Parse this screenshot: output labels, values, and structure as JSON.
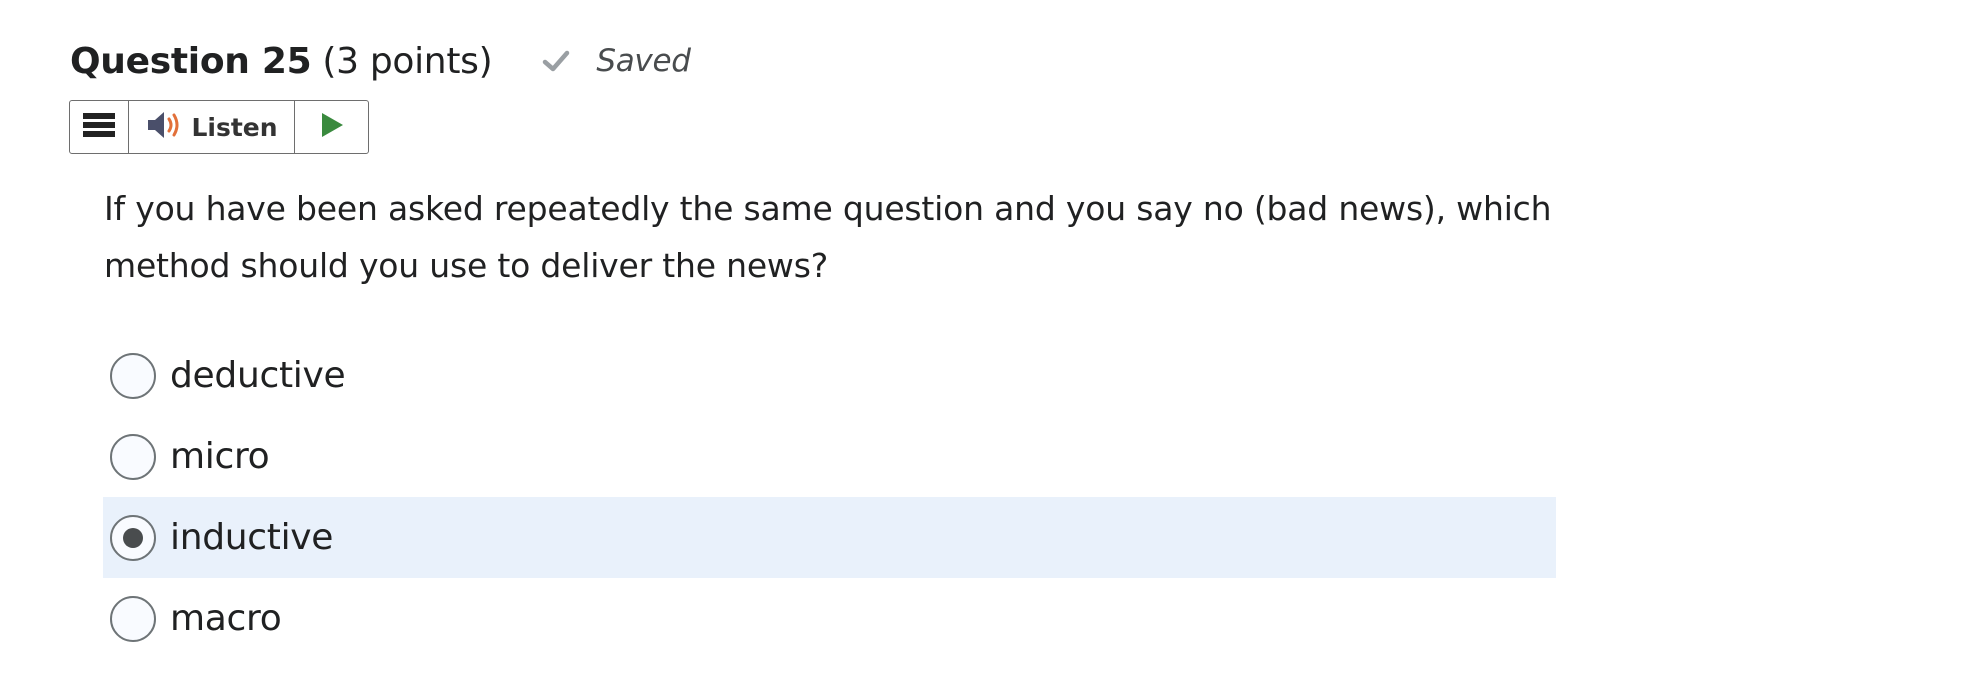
{
  "question": {
    "title": "Question 25",
    "points": "(3 points)",
    "status": "Saved",
    "text": "If you have been asked repeatedly the same question and you say no (bad news), which method should you use to deliver the news?",
    "options": [
      {
        "label": "deductive",
        "selected": false
      },
      {
        "label": "micro",
        "selected": false
      },
      {
        "label": "inductive",
        "selected": true
      },
      {
        "label": "macro",
        "selected": false
      }
    ]
  },
  "toolbar": {
    "listen_label": "Listen",
    "icons": {
      "menu": "menu-icon",
      "speaker": "speaker-icon",
      "play": "play-icon"
    }
  },
  "colors": {
    "selected_row_bg": "#e9f1fb",
    "play_green": "#3a8a3e",
    "speaker_orange": "#e2703a",
    "check_gray": "#9a9fa3"
  }
}
